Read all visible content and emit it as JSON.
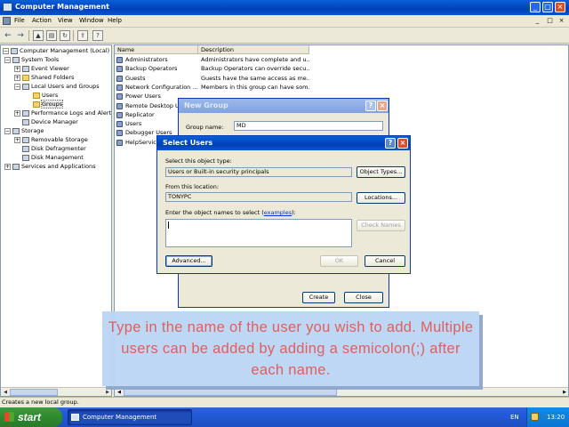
{
  "window": {
    "title": "Computer Management",
    "min": "_",
    "max": "□",
    "close": "×"
  },
  "menubar": {
    "items": [
      "File",
      "Action",
      "View",
      "Window",
      "Help"
    ],
    "mdi_min": "_",
    "mdi_max": "□",
    "mdi_close": "×"
  },
  "toolbar": {
    "back": "←",
    "forward": "→"
  },
  "tree": {
    "root": "Computer Management (Local)",
    "nodes": [
      {
        "label": "System Tools",
        "exp": "−"
      },
      {
        "label": "Event Viewer",
        "exp": "+"
      },
      {
        "label": "Shared Folders",
        "exp": "+"
      },
      {
        "label": "Local Users and Groups",
        "exp": "−"
      },
      {
        "label": "Users",
        "exp": ""
      },
      {
        "label": "Groups",
        "exp": ""
      },
      {
        "label": "Performance Logs and Alerts",
        "exp": "+"
      },
      {
        "label": "Device Manager",
        "exp": ""
      },
      {
        "label": "Storage",
        "exp": "−"
      },
      {
        "label": "Removable Storage",
        "exp": "+"
      },
      {
        "label": "Disk Defragmenter",
        "exp": ""
      },
      {
        "label": "Disk Management",
        "exp": ""
      },
      {
        "label": "Services and Applications",
        "exp": "+"
      }
    ],
    "root_exp": "−"
  },
  "list": {
    "columns": [
      "Name",
      "Description"
    ],
    "rows": [
      {
        "name": "Administrators",
        "desc": "Administrators have complete and u..."
      },
      {
        "name": "Backup Operators",
        "desc": "Backup Operators can override secu..."
      },
      {
        "name": "Guests",
        "desc": "Guests have the same access as me..."
      },
      {
        "name": "Network Configuration ...",
        "desc": "Members in this group can have som..."
      },
      {
        "name": "Power Users",
        "desc": ""
      },
      {
        "name": "Remote Desktop Users",
        "desc": ""
      },
      {
        "name": "Replicator",
        "desc": ""
      },
      {
        "name": "Users",
        "desc": ""
      },
      {
        "name": "Debugger Users",
        "desc": ""
      },
      {
        "name": "HelpServicesGroup",
        "desc": ""
      }
    ]
  },
  "status": "Creates a new local group.",
  "new_group": {
    "title": "New Group",
    "help": "?",
    "close": "×",
    "group_name_label": "Group name:",
    "group_name_value": "MD",
    "create": "Create",
    "close_btn": "Close"
  },
  "select_users": {
    "title": "Select Users",
    "help": "?",
    "close": "×",
    "object_type_label": "Select this object type:",
    "object_type_value": "Users or Built-in security principals",
    "object_types_btn": "Object Types...",
    "location_label": "From this location:",
    "location_value": "TONYPC",
    "locations_btn": "Locations...",
    "names_label": "Enter the object names to select (",
    "names_link": "examples",
    "names_label_end": "):",
    "names_value": "",
    "check_names_btn": "Check Names",
    "advanced_btn": "Advanced...",
    "ok_btn": "OK",
    "cancel_btn": "Cancel"
  },
  "overlay": {
    "text": "Type in the name of the user you wish to add. Multiple users can be added by adding a semicolon(;) after each name."
  },
  "taskbar": {
    "start": "start",
    "task": "Computer Management",
    "lang": "EN",
    "clock": "13:20"
  }
}
